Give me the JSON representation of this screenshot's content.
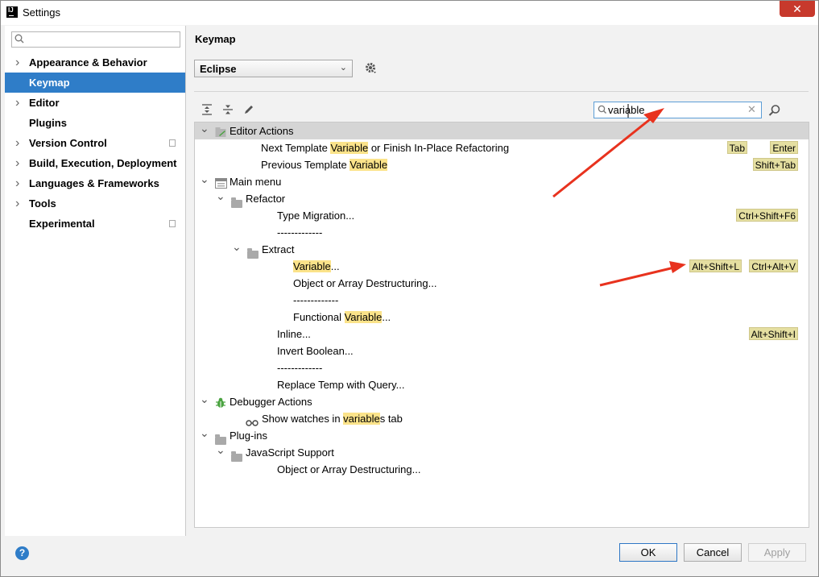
{
  "window": {
    "title": "Settings",
    "close_label": "✕"
  },
  "sidebar": {
    "search_placeholder": "",
    "items": [
      {
        "label": "Appearance & Behavior",
        "expandable": true,
        "selected": false,
        "project_icon": false
      },
      {
        "label": "Keymap",
        "expandable": false,
        "selected": true,
        "project_icon": false
      },
      {
        "label": "Editor",
        "expandable": true,
        "selected": false,
        "project_icon": false
      },
      {
        "label": "Plugins",
        "expandable": false,
        "selected": false,
        "project_icon": false
      },
      {
        "label": "Version Control",
        "expandable": true,
        "selected": false,
        "project_icon": true
      },
      {
        "label": "Build, Execution, Deployment",
        "expandable": true,
        "selected": false,
        "project_icon": false
      },
      {
        "label": "Languages & Frameworks",
        "expandable": true,
        "selected": false,
        "project_icon": false
      },
      {
        "label": "Tools",
        "expandable": true,
        "selected": false,
        "project_icon": false
      },
      {
        "label": "Experimental",
        "expandable": false,
        "selected": false,
        "project_icon": true
      }
    ]
  },
  "main": {
    "title": "Keymap",
    "keymap_value": "Eclipse",
    "search_value": "variable",
    "tree": [
      {
        "parts": [
          "Editor Actions"
        ],
        "hl": [],
        "shortcuts": []
      },
      {
        "parts": [
          "Next Template ",
          "Variable",
          " or Finish In-Place Refactoring"
        ],
        "hl": [
          1
        ],
        "shortcuts": [
          "Tab",
          "Enter"
        ]
      },
      {
        "parts": [
          "Previous Template ",
          "Variable"
        ],
        "hl": [
          1
        ],
        "shortcuts": [
          "Shift+Tab"
        ]
      },
      {
        "parts": [
          "Main menu"
        ],
        "hl": [],
        "shortcuts": []
      },
      {
        "parts": [
          "Refactor"
        ],
        "hl": [],
        "shortcuts": []
      },
      {
        "parts": [
          "Type Migration..."
        ],
        "hl": [],
        "shortcuts": [
          "Ctrl+Shift+F6"
        ]
      },
      {
        "parts": [
          "-------------"
        ],
        "hl": [],
        "shortcuts": []
      },
      {
        "parts": [
          "Extract"
        ],
        "hl": [],
        "shortcuts": []
      },
      {
        "parts": [
          "Variable",
          "..."
        ],
        "hl": [
          0
        ],
        "shortcuts": [
          "Alt+Shift+L",
          "Ctrl+Alt+V"
        ]
      },
      {
        "parts": [
          "Object or Array Destructuring..."
        ],
        "hl": [],
        "shortcuts": []
      },
      {
        "parts": [
          "-------------"
        ],
        "hl": [],
        "shortcuts": []
      },
      {
        "parts": [
          "Functional ",
          "Variable",
          "..."
        ],
        "hl": [
          1
        ],
        "shortcuts": []
      },
      {
        "parts": [
          "Inline..."
        ],
        "hl": [],
        "shortcuts": [
          "Alt+Shift+I"
        ]
      },
      {
        "parts": [
          "Invert Boolean..."
        ],
        "hl": [],
        "shortcuts": []
      },
      {
        "parts": [
          "-------------"
        ],
        "hl": [],
        "shortcuts": []
      },
      {
        "parts": [
          "Replace Temp with Query..."
        ],
        "hl": [],
        "shortcuts": []
      },
      {
        "parts": [
          "Debugger Actions"
        ],
        "hl": [],
        "shortcuts": []
      },
      {
        "parts": [
          "Show watches in ",
          "variable",
          "s tab"
        ],
        "hl": [
          1
        ],
        "shortcuts": []
      },
      {
        "parts": [
          "Plug-ins"
        ],
        "hl": [],
        "shortcuts": []
      },
      {
        "parts": [
          "JavaScript Support"
        ],
        "hl": [],
        "shortcuts": []
      },
      {
        "parts": [
          "Object or Array Destructuring..."
        ],
        "hl": [],
        "shortcuts": []
      }
    ]
  },
  "footer": {
    "help_label": "?",
    "ok_label": "OK",
    "cancel_label": "Cancel",
    "apply_label": "Apply"
  },
  "colors": {
    "selection": "#2f7dc8",
    "match_highlight": "#fbe38a",
    "shortcut_bg": "#e5dfa1",
    "annotation_arrow": "#e8321e"
  }
}
